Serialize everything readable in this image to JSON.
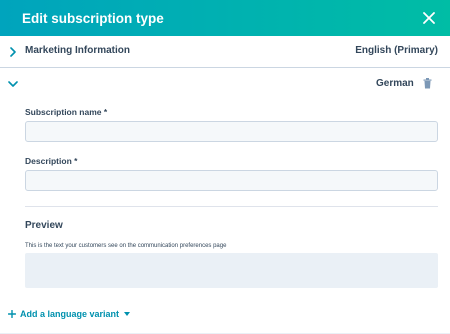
{
  "header": {
    "title": "Edit subscription type"
  },
  "sections": {
    "collapsed": {
      "title": "Marketing Information",
      "language": "English (Primary)"
    },
    "expanded": {
      "language": "German"
    }
  },
  "form": {
    "subscription_name_label": "Subscription name *",
    "subscription_name_value": "",
    "description_label": "Description *",
    "description_value": ""
  },
  "preview": {
    "title": "Preview",
    "text": "This is the text your customers see on the communication preferences page"
  },
  "footer": {
    "add_language_label": "Add a language variant"
  },
  "colors": {
    "header_gradient_start": "#00a4bd",
    "header_gradient_end": "#00bda5",
    "link": "#0091ae",
    "text": "#33475b"
  },
  "icons": [
    "close-icon",
    "chevron-right-icon",
    "chevron-down-icon",
    "trash-icon",
    "plus-icon",
    "caret-down-icon"
  ]
}
